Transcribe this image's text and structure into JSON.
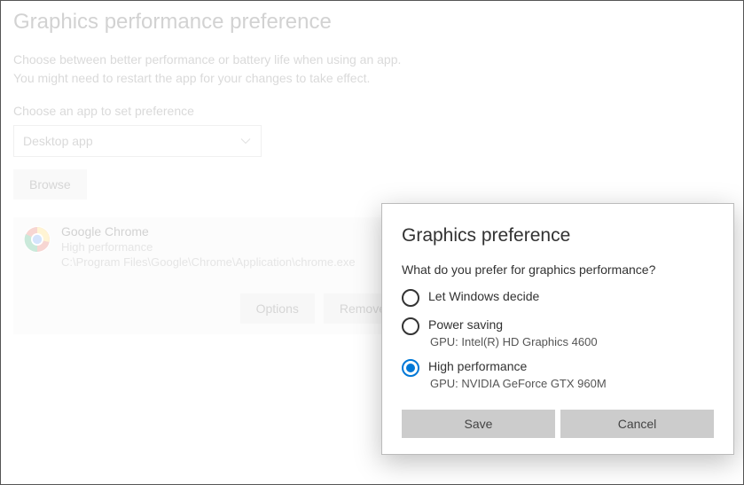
{
  "page": {
    "title": "Graphics performance preference",
    "desc_line1": "Choose between better performance or battery life when using an app.",
    "desc_line2": "You might need to restart the app for your changes to take effect.",
    "choose_label": "Choose an app to set preference",
    "select_value": "Desktop app",
    "browse_label": "Browse"
  },
  "app": {
    "name": "Google Chrome",
    "perf": "High performance",
    "path": "C:\\Program Files\\Google\\Chrome\\Application\\chrome.exe",
    "options_label": "Options",
    "remove_label": "Remove"
  },
  "dialog": {
    "title": "Graphics preference",
    "question": "What do you prefer for graphics performance?",
    "options": [
      {
        "label": "Let Windows decide",
        "sub": "",
        "selected": false
      },
      {
        "label": "Power saving",
        "sub": "GPU: Intel(R) HD Graphics 4600",
        "selected": false
      },
      {
        "label": "High performance",
        "sub": "GPU: NVIDIA GeForce GTX 960M",
        "selected": true
      }
    ],
    "save_label": "Save",
    "cancel_label": "Cancel"
  }
}
